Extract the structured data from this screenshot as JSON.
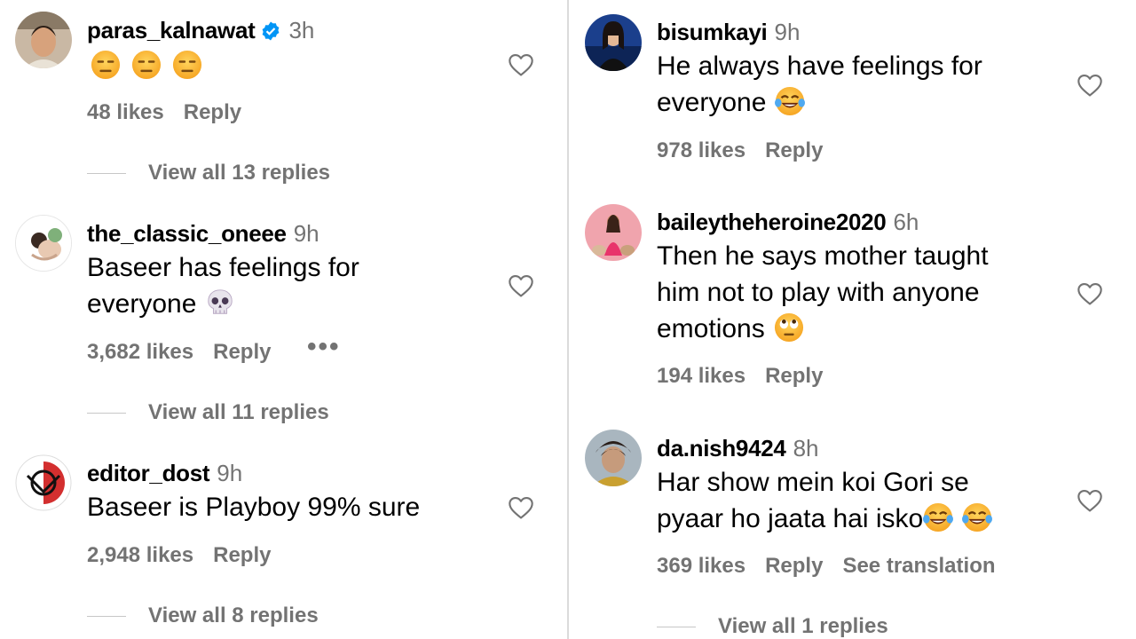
{
  "colors": {
    "meta": "#737373",
    "verified": "#0095f6",
    "divider": "#dbdbdb"
  },
  "left": [
    {
      "username": "paras_kalnawat",
      "verified": true,
      "time": "3h",
      "text": "",
      "emoji": [
        "expressionless-face",
        "expressionless-face",
        "expressionless-face"
      ],
      "likes": "48 likes",
      "reply": "Reply",
      "view_replies": "View all 13 replies"
    },
    {
      "username": "the_classic_oneee",
      "verified": false,
      "time": "9h",
      "text_line1": "Baseer has feelings for",
      "text_line2": "everyone",
      "emoji": [
        "skull"
      ],
      "likes": "3,682 likes",
      "reply": "Reply",
      "more": "•••",
      "view_replies": "View all 11 replies"
    },
    {
      "username": "editor_dost",
      "verified": false,
      "time": "9h",
      "text_line1": "Baseer is Playboy 99% sure",
      "likes": "2,948 likes",
      "reply": "Reply",
      "view_replies": "View all 8 replies"
    }
  ],
  "right": [
    {
      "username": "bisumkayi",
      "time": "9h",
      "text_line1": "He always have feelings for",
      "text_line2": "everyone",
      "emoji": [
        "tears-of-joy"
      ],
      "likes": "978 likes",
      "reply": "Reply"
    },
    {
      "username": "baileytheheroine2020",
      "time": "6h",
      "text_line1": "Then he says mother taught",
      "text_line2": "him not to play with anyone",
      "text_line3": "emotions",
      "emoji": [
        "eye-roll-face"
      ],
      "likes": "194 likes",
      "reply": "Reply"
    },
    {
      "username": "da.nish9424",
      "time": "8h",
      "text_line1": "Har show mein koi Gori se",
      "text_line2": "pyaar ho jaata hai isko",
      "emoji": [
        "tears-of-joy",
        "tears-of-joy"
      ],
      "likes": "369 likes",
      "reply": "Reply",
      "see_translation": "See translation",
      "view_replies": "View all 1 replies"
    }
  ]
}
